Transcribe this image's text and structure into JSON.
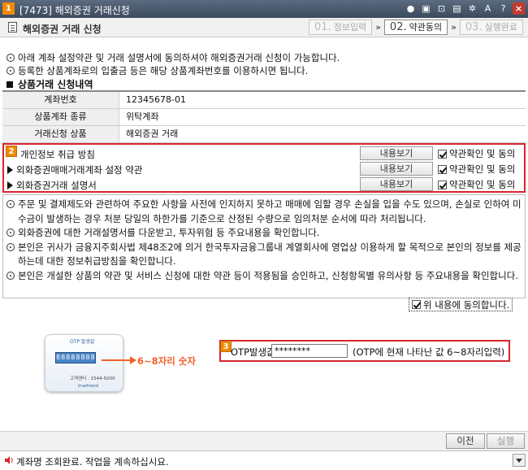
{
  "window": {
    "badge_num": "1",
    "title": "[7473] 해외증권 거래신청",
    "icons": [
      "pin-icon",
      "window-icon",
      "screenshot-icon",
      "keep-on-top-icon",
      "settings-icon",
      "font-size-icon",
      "help-icon",
      "close-icon"
    ]
  },
  "header": {
    "page_title": "해외증권 거래 신청",
    "steps": [
      {
        "num": "01.",
        "label": "정보입력",
        "active": false
      },
      {
        "num": "02.",
        "label": "약관동의",
        "active": true
      },
      {
        "num": "03.",
        "label": "실행완료",
        "active": false
      }
    ],
    "arrow": "»"
  },
  "notices": [
    "아래 계좌 설정약관 및 거래 설명서에 동의하셔야 해외증권거래 신청이 가능합니다.",
    "등록한 상품계좌로의 입출금 등은 해당 상품계좌번호를 이용하시면 됩니다."
  ],
  "section_title": "상품거래 신청내역",
  "account": {
    "rows": [
      {
        "label": "계좌번호",
        "value": "12345678-01"
      },
      {
        "label": "상품계좌 종류",
        "value": "위탁계좌"
      },
      {
        "label": "거래신청 상품",
        "value": "해외증권 거래"
      }
    ]
  },
  "agreements": {
    "badge": "2",
    "view_label": "내용보기",
    "check_label": "약관확인 및 동의",
    "items": [
      {
        "label": "개인정보 취급 방침",
        "checked": true
      },
      {
        "label": "외화증권매매거래계좌 설정 약관",
        "checked": true
      },
      {
        "label": "외화증권거래 설명서",
        "checked": true
      }
    ]
  },
  "notes": [
    "주문 및 결제제도와 관련하여 주요한 사항을 사전에 인지하지 못하고 매매에 임할 경우 손실을 입을 수도 있으며, 손실로 인하여 미수금이 발생하는 경우 처분 당일의 하한가를 기준으로 산정된 수량으로 임의처분 순서에 따라 처리됩니다.",
    "외화증권에 대한 거래설명서를 다운받고, 투자위험 등 주요내용을 확인합니다.",
    "본인은 귀사가 금융지주회사법 제48조2에 의거 한국투자금융그룹내 계열회사에 영업상 이용하게 할 목적으로 본인의 정보를 제공하는데 대한 정보취급방침을 확인합니다.",
    "본인은 개설한 상품의 약관 및 서비스 신청에 대한 약관 등이 적용됨을 승인하고, 신청항목별 유의사항 등 주요내용을 확인합니다."
  ],
  "agree_all": {
    "label": "위 내용에 동의합니다.",
    "checked": true
  },
  "otp": {
    "badge": "3",
    "card_title": "OTP 발생값",
    "card_screen": "88888888",
    "card_cs": "고객센터 : 1544-5000",
    "card_brand": "truefriend",
    "hint": "6~8자리 숫자",
    "label": "OTP발생값",
    "value": "********",
    "desc": "(OTP에 현재 나타난 값 6~8자리입력)"
  },
  "buttons": {
    "prev": "이전",
    "run": "실행"
  },
  "status": {
    "message": "계좌명 조회완료. 작업을 계속하십시요."
  },
  "colors": {
    "highlight": "#d7262e",
    "badge": "#f08a00",
    "hint": "#f0622a",
    "titlebar": "#3c4a5c"
  }
}
